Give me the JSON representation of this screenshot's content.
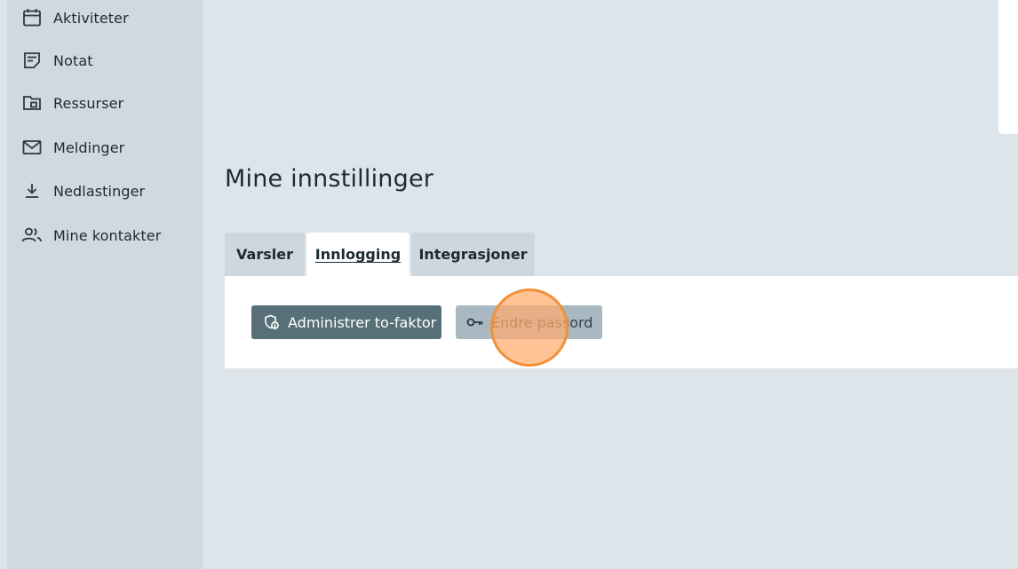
{
  "sidebar": {
    "items": [
      {
        "label": "Aktiviteter",
        "icon": "calendar-icon"
      },
      {
        "label": "Notat",
        "icon": "note-icon"
      },
      {
        "label": "Ressurser",
        "icon": "folder-icon"
      },
      {
        "label": "Meldinger",
        "icon": "mail-icon"
      },
      {
        "label": "Nedlastinger",
        "icon": "download-icon"
      },
      {
        "label": "Mine kontakter",
        "icon": "contacts-icon"
      }
    ]
  },
  "main": {
    "title": "Mine innstillinger",
    "tabs": [
      {
        "label": "Varsler",
        "active": false
      },
      {
        "label": "Innlogging",
        "active": true
      },
      {
        "label": "Integrasjoner",
        "active": false
      }
    ],
    "actions": {
      "two_factor_label": "Administrer to-faktor",
      "two_factor_icon": "shield-icon",
      "change_password_label": "Endre passord",
      "change_password_icon": "key-icon"
    }
  },
  "colors": {
    "background": "#dde5eb",
    "sidebar": "#cfdadf",
    "primary_button": "#577078",
    "secondary_button": "#a9b8c1",
    "click_indicator": "#f0913a"
  }
}
